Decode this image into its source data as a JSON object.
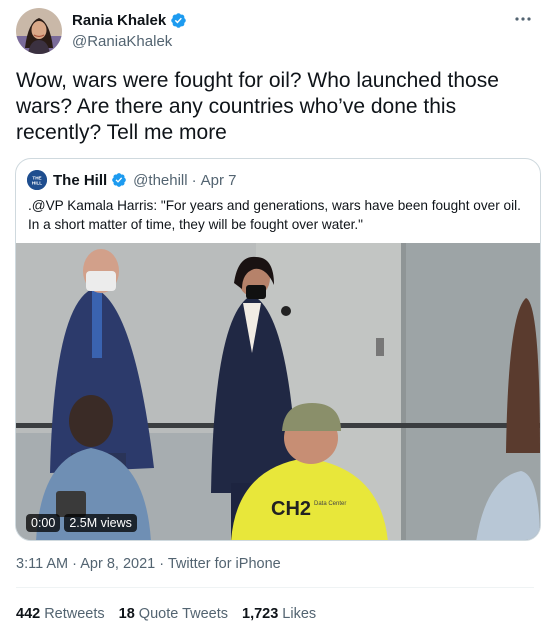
{
  "author": {
    "name": "Rania Khalek",
    "handle": "@RaniaKhalek",
    "verified": true
  },
  "tweet": {
    "text": "Wow, wars were fought for oil? Who launched those wars? Are there any countries who’ve done this recently? Tell me more"
  },
  "quoted": {
    "logo_text": "THE HILL",
    "name": "The Hill",
    "handle": "@thehill",
    "separator": "·",
    "date": "Apr 7",
    "text": ".@VP Kamala Harris: \"For years and generations, wars have been fought over oil. In a short matter of time, they will be fought over water.\"",
    "video": {
      "time": "0:00",
      "views": "2.5M views",
      "shirt_text": "CH2",
      "shirt_small": "Data Center"
    }
  },
  "meta": {
    "time": "3:11 AM",
    "sep1": "·",
    "date": "Apr 8, 2021",
    "sep2": "·",
    "source": "Twitter for iPhone"
  },
  "stats": {
    "retweets_count": "442",
    "retweets_label": "Retweets",
    "quotes_count": "18",
    "quotes_label": "Quote Tweets",
    "likes_count": "1,723",
    "likes_label": "Likes"
  },
  "colors": {
    "verified": "#1d9bf0",
    "secondary_text": "#536471",
    "border": "#cfd9de",
    "divider": "#eff3f4",
    "hill_logo": "#1f4e8f"
  },
  "icons": [
    "verified-badge-icon",
    "more-icon"
  ]
}
